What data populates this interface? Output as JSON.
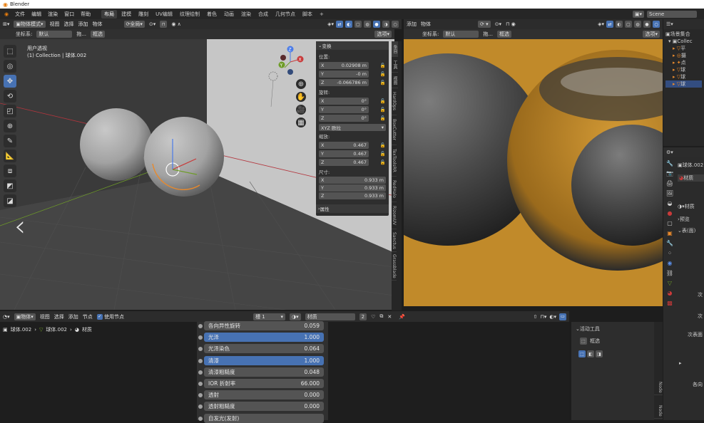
{
  "app": {
    "title": "Blender"
  },
  "menu": {
    "items": [
      "文件",
      "编辑",
      "渲染",
      "窗口",
      "帮助"
    ],
    "workspaces": [
      "布局",
      "建模",
      "雕刻",
      "UV编辑",
      "纹理绘制",
      "着色",
      "动画",
      "渲染",
      "合成",
      "几何节点",
      "脚本"
    ],
    "active_workspace": "布局",
    "add_tab": "+",
    "scene_label": "Scene"
  },
  "viewport": {
    "mode": "物体模式",
    "menus": [
      "视图",
      "选择",
      "添加",
      "物体"
    ],
    "transform_orientation": "全局",
    "coord_label": "坐标系:",
    "coord_value": "默认",
    "drag_label": "拖...",
    "select_mode": "框选",
    "options": "选项",
    "view_name": "用户透视",
    "collection_info": "(1) Collection | 球体.002",
    "axis_x": "X",
    "axis_y": "Y",
    "axis_z": "Z"
  },
  "npanel": {
    "section_transform": "变换",
    "location_label": "位置:",
    "location": {
      "x": "0.02908 m",
      "y": "-0 m",
      "z": "-0.066786 m"
    },
    "rotation_label": "旋转:",
    "rotation": {
      "x": "0°",
      "y": "0°",
      "z": "0°"
    },
    "rotation_mode": "XYZ 欧拉",
    "scale_label": "缩放:",
    "scale": {
      "x": "0.467",
      "y": "0.467",
      "z": "0.467"
    },
    "dimensions_label": "尺寸:",
    "dimensions": {
      "x": "0.933 m",
      "y": "0.933 m",
      "z": "0.933 m"
    },
    "section_properties": "属性"
  },
  "side_tabs": [
    "条目",
    "工具",
    "视图",
    "HardOps",
    "BoxCutter",
    "TexToolsRR",
    "RedHalo",
    "RizomUV",
    "Sanctus",
    "Grassblade"
  ],
  "render_view": {
    "menus": [
      "添加",
      "物体"
    ],
    "coord_label": "坐标系:",
    "coord_value": "默认",
    "drag_label": "拖...",
    "select_mode": "框选",
    "options": "选项"
  },
  "outliner": {
    "root": "场景集合",
    "collection": "Collec",
    "items": [
      "平",
      "摄",
      "点",
      "球",
      "球",
      "球"
    ]
  },
  "properties": {
    "object_name": "球体.002",
    "material_tab": "材质",
    "preview": "预览",
    "surface": "表(面)",
    "labels": [
      "次",
      "次",
      "次表面"
    ],
    "bottom_label": "各向"
  },
  "node_editor": {
    "type": "物体",
    "menus": [
      "视图",
      "选择",
      "添加",
      "节点"
    ],
    "use_nodes": "使用节点",
    "slot": "槽 1",
    "material": "材质",
    "users": "2",
    "breadcrumb": [
      "球体.002",
      "球体.002",
      "材质"
    ]
  },
  "bsdf": {
    "rows": [
      {
        "label": "各向异性旋转",
        "value": "0.059",
        "highlight": false
      },
      {
        "label": "光泽",
        "value": "1.000",
        "highlight": true
      },
      {
        "label": "光泽染色",
        "value": "0.064",
        "highlight": false
      },
      {
        "label": "清漆",
        "value": "1.000",
        "highlight": true
      },
      {
        "label": "清漆粗糙度",
        "value": "0.048",
        "highlight": false
      },
      {
        "label": "IOR 折射率",
        "value": "66.000",
        "highlight": false
      },
      {
        "label": "透射",
        "value": "0.000",
        "highlight": false
      },
      {
        "label": "透射粗糙度",
        "value": "0.000",
        "highlight": false
      },
      {
        "label": "自发光(发射)",
        "value": "",
        "highlight": false
      }
    ]
  },
  "tool_settings": {
    "header": "活动工具",
    "tool": "框选",
    "side_tabs": [
      "Node",
      "Node"
    ]
  },
  "colors": {
    "accent": "#4772b3",
    "render_bg": "#c18a2a",
    "axis_red": "#b3353d",
    "axis_green": "#6e9c28"
  }
}
